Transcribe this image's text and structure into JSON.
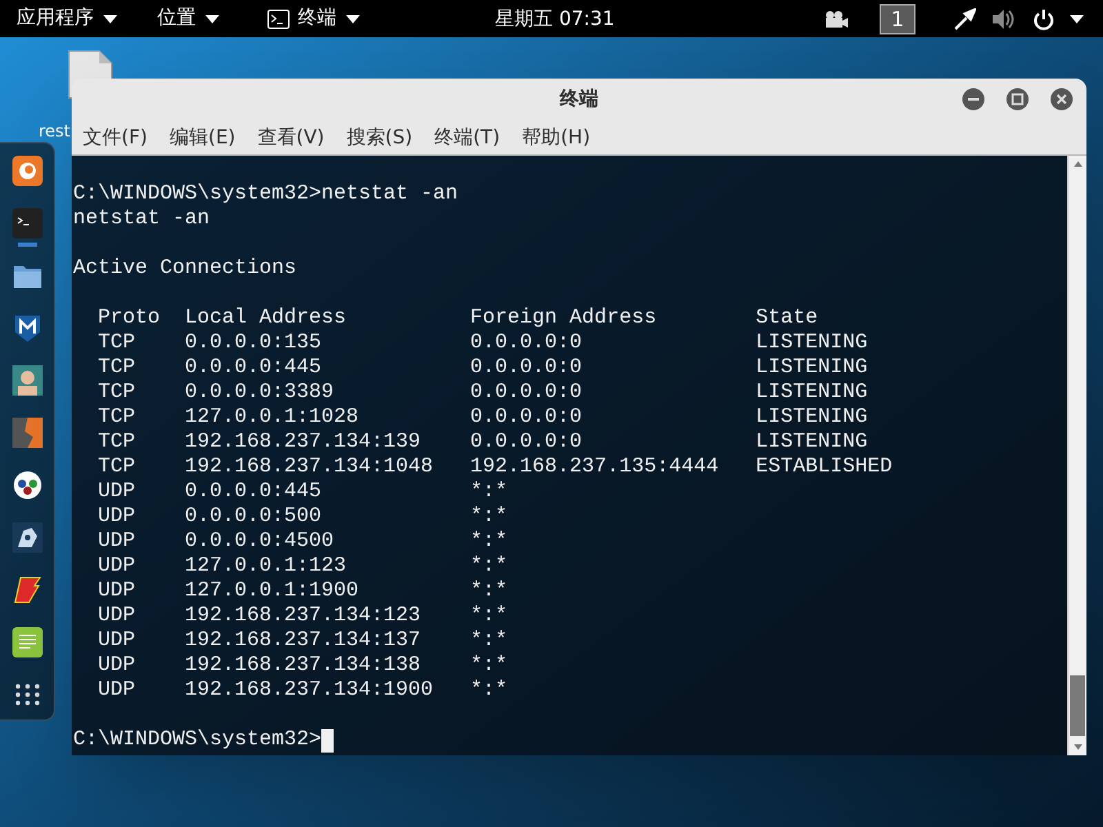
{
  "top_bar": {
    "menus": [
      {
        "label": "应用程序",
        "kind": "menu"
      },
      {
        "label": "位置",
        "kind": "menu"
      },
      {
        "label": "终端",
        "kind": "app"
      }
    ],
    "clock": "星期五 07:31",
    "workspace": "1"
  },
  "desktop": {
    "icons": [
      {
        "lines": [
          "rest"
        ]
      }
    ]
  },
  "dock": {
    "items": [
      {
        "kind": "firefox",
        "running": false
      },
      {
        "kind": "terminal",
        "running": true
      },
      {
        "kind": "folder",
        "running": false
      },
      {
        "kind": "metasploit",
        "running": false
      },
      {
        "kind": "armitage",
        "running": false
      },
      {
        "kind": "burp",
        "running": false
      },
      {
        "kind": "maltego",
        "running": false
      },
      {
        "kind": "beef",
        "running": false
      },
      {
        "kind": "faraday",
        "running": false
      },
      {
        "kind": "notes",
        "running": false
      },
      {
        "kind": "apps",
        "running": false
      }
    ]
  },
  "window": {
    "title": "终端",
    "menu": [
      "文件(F)",
      "编辑(E)",
      "查看(V)",
      "搜索(S)",
      "终端(T)",
      "帮助(H)"
    ],
    "lines": [
      {
        "kind": "text",
        "text": "C:\\WINDOWS\\system32>netstat -an"
      },
      {
        "kind": "text",
        "text": "netstat -an"
      },
      {
        "kind": "blank"
      },
      {
        "kind": "text",
        "text": "Active Connections"
      },
      {
        "kind": "blank"
      },
      {
        "kind": "text",
        "text": "  Proto  Local Address          Foreign Address        State"
      },
      {
        "kind": "text",
        "text": "  TCP    0.0.0.0:135            0.0.0.0:0              LISTENING"
      },
      {
        "kind": "text",
        "text": "  TCP    0.0.0.0:445            0.0.0.0:0              LISTENING"
      },
      {
        "kind": "text",
        "text": "  TCP    0.0.0.0:3389           0.0.0.0:0              LISTENING"
      },
      {
        "kind": "text",
        "text": "  TCP    127.0.0.1:1028         0.0.0.0:0              LISTENING"
      },
      {
        "kind": "text",
        "text": "  TCP    192.168.237.134:139    0.0.0.0:0              LISTENING"
      },
      {
        "kind": "text",
        "text": "  TCP    192.168.237.134:1048   192.168.237.135:4444   ESTABLISHED"
      },
      {
        "kind": "text",
        "text": "  UDP    0.0.0.0:445            *:*"
      },
      {
        "kind": "text",
        "text": "  UDP    0.0.0.0:500            *:*"
      },
      {
        "kind": "text",
        "text": "  UDP    0.0.0.0:4500           *:*"
      },
      {
        "kind": "text",
        "text": "  UDP    127.0.0.1:123          *:*"
      },
      {
        "kind": "text",
        "text": "  UDP    127.0.0.1:1900         *:*"
      },
      {
        "kind": "text",
        "text": "  UDP    192.168.237.134:123    *:*"
      },
      {
        "kind": "text",
        "text": "  UDP    192.168.237.134:137    *:*"
      },
      {
        "kind": "text",
        "text": "  UDP    192.168.237.134:138    *:*"
      },
      {
        "kind": "text",
        "text": "  UDP    192.168.237.134:1900   *:*"
      },
      {
        "kind": "blank"
      },
      {
        "kind": "prompt",
        "text": "C:\\WINDOWS\\system32>",
        "cursor": true
      }
    ]
  }
}
